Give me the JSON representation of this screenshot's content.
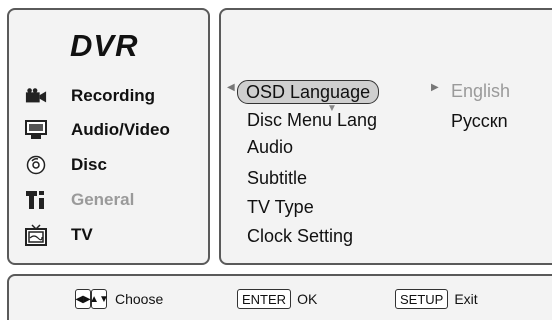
{
  "sidebar": {
    "brand": "DVR",
    "items": [
      {
        "label": "Recording",
        "icon": "camera-icon",
        "enabled": true
      },
      {
        "label": "Audio/Video",
        "icon": "monitor-icon",
        "enabled": true
      },
      {
        "label": "Disc",
        "icon": "disc-icon",
        "enabled": true
      },
      {
        "label": "General",
        "icon": "tools-icon",
        "enabled": false
      },
      {
        "label": "TV",
        "icon": "tv-icon",
        "enabled": true
      }
    ]
  },
  "menu": {
    "items": [
      {
        "label": "OSD Language",
        "selected": true
      },
      {
        "label": "Disc Menu Lang",
        "selected": false
      },
      {
        "label": "Audio",
        "selected": false
      },
      {
        "label": "Subtitle",
        "selected": false
      },
      {
        "label": "TV Type",
        "selected": false
      },
      {
        "label": "Clock Setting",
        "selected": false
      }
    ],
    "options": [
      {
        "label": "English",
        "current": true
      },
      {
        "label": "Русскn",
        "current": false
      }
    ]
  },
  "footer": {
    "choose_label": "Choose",
    "enter_key": "ENTER",
    "enter_label": "OK",
    "setup_key": "SETUP",
    "setup_label": "Exit"
  },
  "colors": {
    "panel_bg": "#f3f3f3",
    "border": "#5a5a5a",
    "highlight": "#cfcfcf",
    "disabled_text": "#9a9a9a"
  }
}
